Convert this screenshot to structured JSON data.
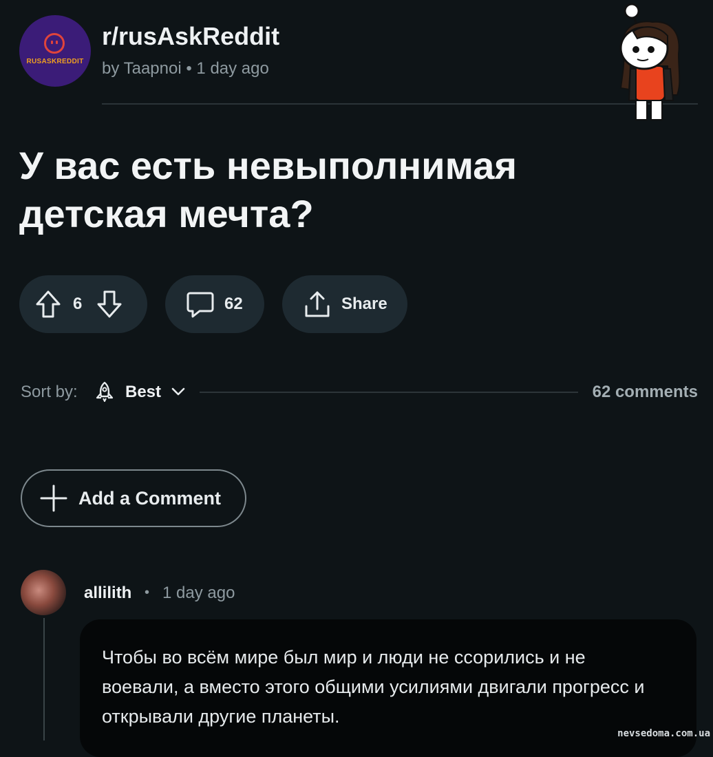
{
  "header": {
    "subreddit": "r/rusAskReddit",
    "avatar_text": "RUSASKREDDIT",
    "author_prefix": "by",
    "author": "Taapnoi",
    "separator": "•",
    "time": "1 day ago"
  },
  "post": {
    "title": "У вас есть невыполнимая детская мечта?",
    "votes": "6",
    "comments": "62",
    "share_label": "Share"
  },
  "sort": {
    "label": "Sort by:",
    "value": "Best",
    "comments_count": "62 comments"
  },
  "add_comment_label": "Add a Comment",
  "comment": {
    "user": "allilith",
    "separator": "•",
    "time": "1 day ago",
    "text": "Чтобы во всём мире был мир и люди не ссорились и не воевали, а вместо этого общими усилиями двигали прогресс и открывали другие планеты."
  },
  "watermark": "nevsedoma.com.ua",
  "colors": {
    "background": "#0e1417",
    "pill": "#1e2a31",
    "muted_text": "#8e9aa0",
    "subreddit_avatar": "#3b1c78",
    "comment_bubble": "#050708"
  }
}
